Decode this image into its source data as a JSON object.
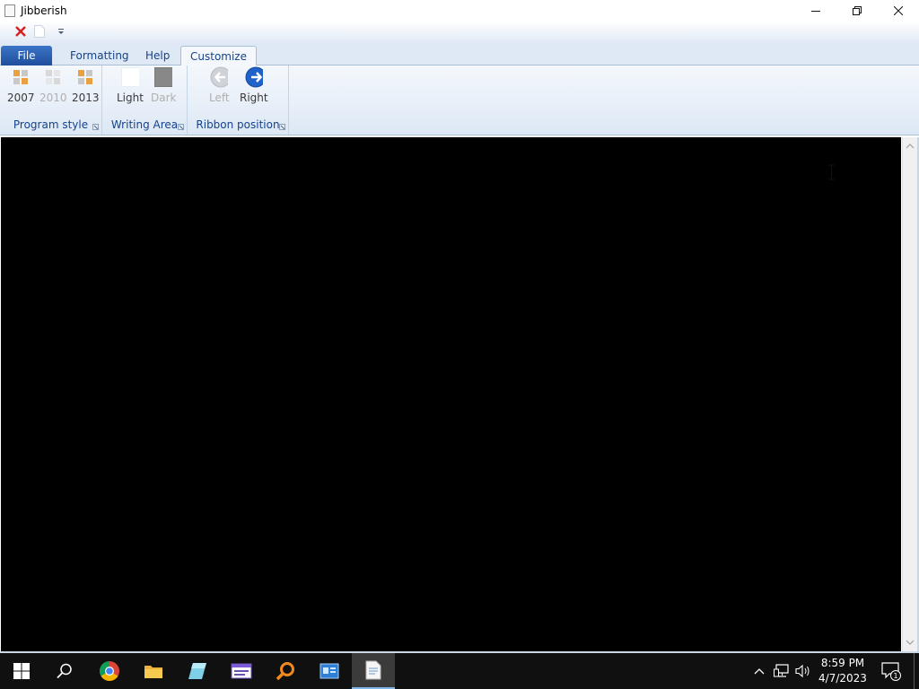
{
  "window": {
    "title": "Jibberish",
    "icon": "notepad-document-icon",
    "controls": {
      "minimize": "minimize-icon",
      "restore": "restore-icon",
      "close": "close-icon"
    }
  },
  "quick_access": [
    {
      "icon": "close-red-x-icon"
    },
    {
      "icon": "new-document-icon"
    },
    {
      "icon": "customize-quick-access-dropdown-icon"
    }
  ],
  "ribbon": {
    "tabs": [
      {
        "label": "File",
        "active": false
      },
      {
        "label": "Formatting",
        "active": false
      },
      {
        "label": "Help",
        "active": false
      },
      {
        "label": "Customize",
        "active": true
      }
    ],
    "groups": [
      {
        "label": "Program style",
        "buttons": [
          {
            "label": "2007",
            "icon": "office-style-icon",
            "enabled": true
          },
          {
            "label": "2010",
            "icon": "office-style-icon",
            "enabled": false
          },
          {
            "label": "2013",
            "icon": "office-style-icon",
            "enabled": true
          }
        ]
      },
      {
        "label": "Writing Area",
        "buttons": [
          {
            "label": "Light",
            "icon": "light-swatch-icon",
            "enabled": true
          },
          {
            "label": "Dark",
            "icon": "dark-swatch-icon",
            "enabled": false
          }
        ]
      },
      {
        "label": "Ribbon position",
        "buttons": [
          {
            "label": "Left",
            "icon": "arrow-left-icon",
            "enabled": false
          },
          {
            "label": "Right",
            "icon": "arrow-right-icon",
            "enabled": true
          }
        ]
      }
    ]
  },
  "editor": {
    "content": "[text omitted]",
    "background": "#000000",
    "text_color": "#ffffff"
  },
  "taskbar": {
    "items": [
      {
        "icon": "windows-start-icon"
      },
      {
        "icon": "search-icon"
      },
      {
        "icon": "chrome-icon"
      },
      {
        "icon": "file-explorer-icon"
      },
      {
        "icon": "notepad-app-icon"
      },
      {
        "icon": "media-app-icon"
      },
      {
        "icon": "magnifier-search-app-icon"
      },
      {
        "icon": "control-panel-icon"
      },
      {
        "icon": "jibberish-app-icon",
        "active": true
      }
    ],
    "tray": {
      "icons": [
        "chevron-up-icon",
        "network-icon",
        "volume-icon"
      ],
      "time": "8:59 PM",
      "date": "4/7/2023",
      "notification_count": "1"
    }
  },
  "colors": {
    "ribbon_text": "#15428b",
    "file_tab": "#2a5fb0",
    "taskbar": "#101010"
  }
}
